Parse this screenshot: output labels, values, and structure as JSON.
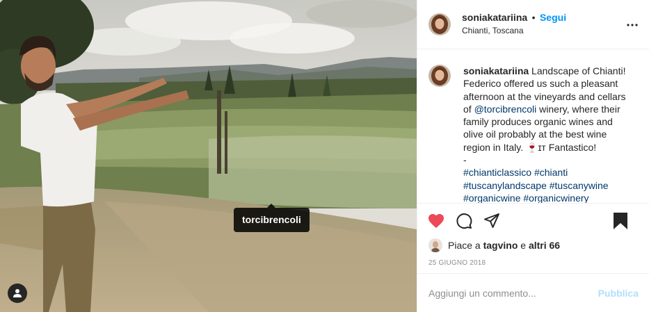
{
  "photo": {
    "tag_label": "torcibrencoli",
    "user_tag_icon": "user-icon"
  },
  "header": {
    "username": "soniakatariina",
    "separator": "•",
    "follow_label": "Segui",
    "location": "Chianti, Toscana",
    "more_icon": "more-horizontal-icon"
  },
  "caption": {
    "username": "soniakatariina",
    "text_before_mention": "Landscape of Chianti! Federico offered us such a pleasant afternoon at the vineyards and cellars of",
    "mention": "@torcibrencoli",
    "text_after_mention": "winery, where their family produces organic wines and olive oil probably at the best wine region in Italy. 🍷ɪᴛ Fantastico!",
    "dash": "-",
    "hashtags": "#chianticlassico #chianti #tuscanylandscape #tuscanywine #organicwine #organicwinery"
  },
  "actions": {
    "like_icon": "heart-filled-icon",
    "comment_icon": "comment-icon",
    "share_icon": "share-icon",
    "save_icon": "bookmark-filled-icon",
    "like_color": "#ed4956"
  },
  "likes": {
    "prefix": "Piace a",
    "user": "tagvino",
    "conjunction": "e",
    "others": "altri 66"
  },
  "date": "25 GIUGNO 2018",
  "comment": {
    "placeholder": "Aggiungi un commento...",
    "publish_label": "Pubblica"
  },
  "colors": {
    "link": "#0095f6",
    "hashtag": "#00376b",
    "muted": "#8e8e8e",
    "publish_disabled": "#b2dffc"
  }
}
